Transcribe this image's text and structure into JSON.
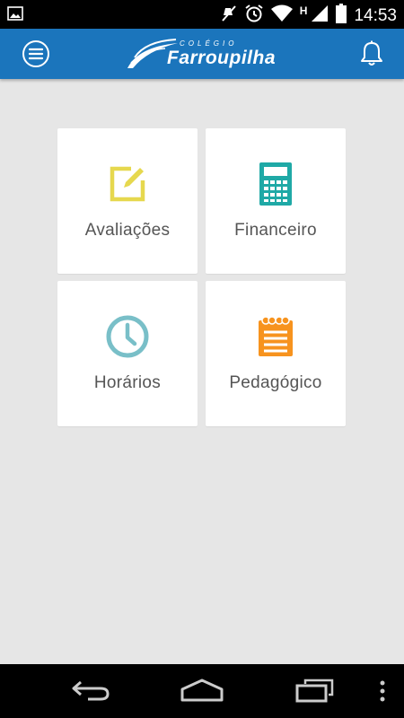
{
  "status_bar": {
    "time": "14:53",
    "network_indicator": "H",
    "icons": [
      "image-notification-icon",
      "mute-icon",
      "alarm-icon",
      "wifi-icon",
      "signal-icon",
      "battery-icon"
    ]
  },
  "app_bar": {
    "logo_subtitle": "COLÉGIO",
    "logo_title": "Farroupilha",
    "color": "#1b75bc"
  },
  "tiles": [
    {
      "label": "Avaliações",
      "icon": "edit-icon",
      "color": "#e6d84e"
    },
    {
      "label": "Financeiro",
      "icon": "calculator-icon",
      "color": "#1fa9a6"
    },
    {
      "label": "Horários",
      "icon": "clock-icon",
      "color": "#79bfc8"
    },
    {
      "label": "Pedagógico",
      "icon": "notepad-icon",
      "color": "#f7931e"
    }
  ],
  "nav_bar": {
    "buttons": [
      "back-icon",
      "home-icon",
      "recents-icon",
      "overflow-menu-icon"
    ]
  }
}
